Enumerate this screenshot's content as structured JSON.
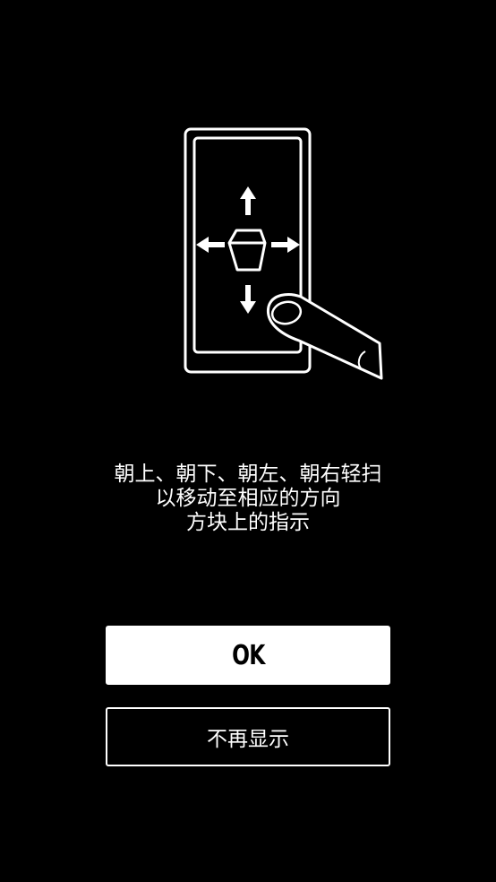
{
  "illustration": {
    "icon": "swipe-gesture-phone-icon",
    "arrows": [
      "arrow-up-icon",
      "arrow-down-icon",
      "arrow-left-icon",
      "arrow-right-icon"
    ]
  },
  "instructions": {
    "lines": [
      "朝上、朝下、朝左、朝右轻扫",
      "以移动至相应的方向",
      "方块上的指示"
    ]
  },
  "buttons": {
    "ok_label": "OK",
    "dismiss_label": "不再显示"
  },
  "colors": {
    "background": "#000000",
    "foreground": "#ffffff"
  }
}
